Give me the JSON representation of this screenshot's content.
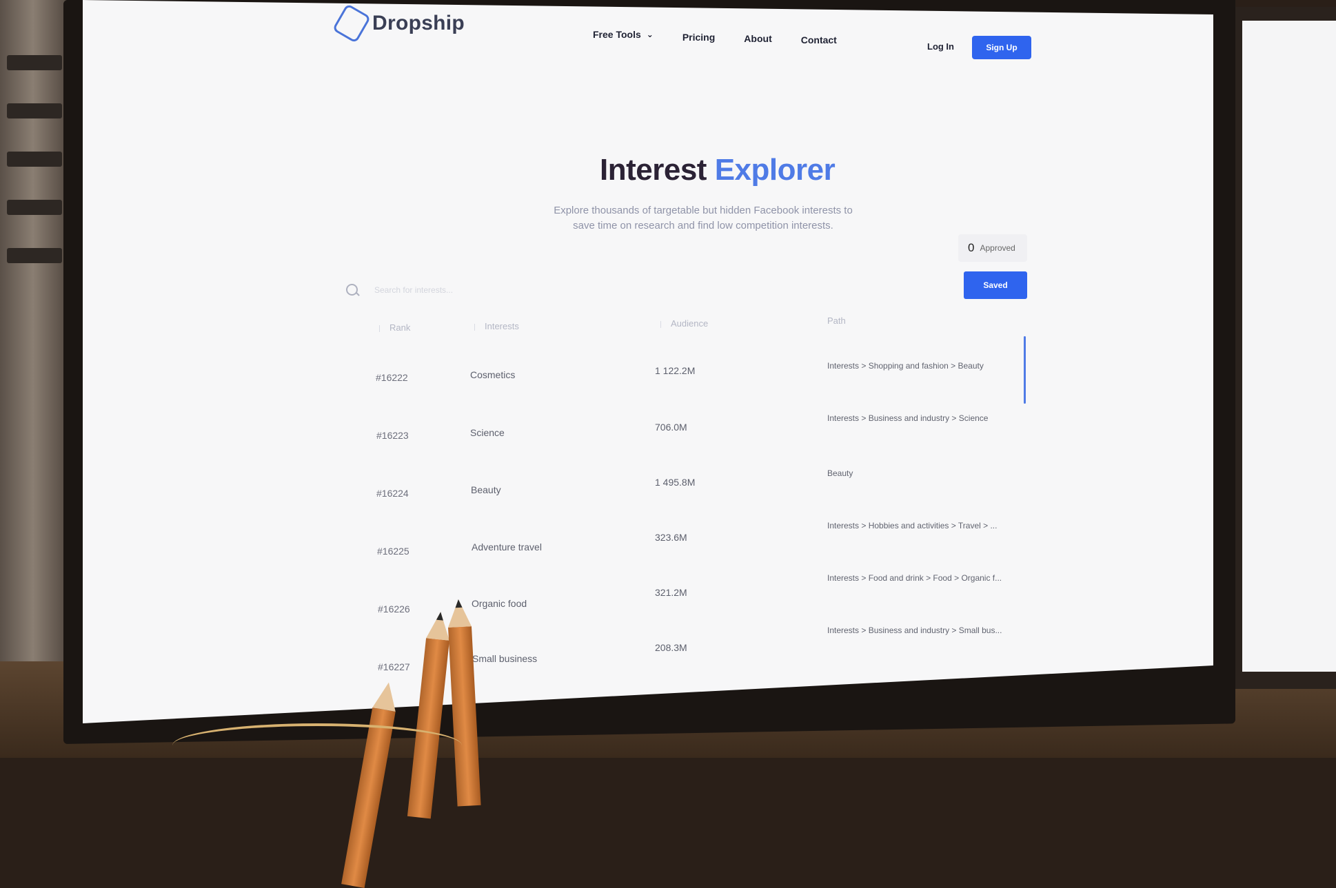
{
  "header": {
    "logo_text": "Dropship",
    "nav": [
      {
        "label": "Free Tools",
        "has_dropdown": true
      },
      {
        "label": "Pricing"
      },
      {
        "label": "About"
      },
      {
        "label": "Contact"
      }
    ],
    "login_label": "Log In",
    "signup_label": "Sign Up"
  },
  "hero": {
    "title_part1": "Interest",
    "title_part2": "Explorer",
    "subtitle_line1": "Explore thousands of targetable but hidden Facebook interests to",
    "subtitle_line2": "save time on research and find low competition interests."
  },
  "approved": {
    "count": "0",
    "label": "Approved"
  },
  "saved_label": "Saved",
  "search": {
    "placeholder": "Search for interests..."
  },
  "table": {
    "columns": [
      "Rank",
      "Interests",
      "Audience",
      "Path"
    ],
    "rows": [
      {
        "rank": "#16222",
        "interest": "Cosmetics",
        "audience": "1 122.2M",
        "path": "Interests > Shopping and fashion > Beauty"
      },
      {
        "rank": "#16223",
        "interest": "Science",
        "audience": "706.0M",
        "path": "Interests > Business and industry > Science"
      },
      {
        "rank": "#16224",
        "interest": "Beauty",
        "audience": "1 495.8M",
        "path": "Beauty"
      },
      {
        "rank": "#16225",
        "interest": "Adventure travel",
        "audience": "323.6M",
        "path": "Interests > Hobbies and activities > Travel > ..."
      },
      {
        "rank": "#16226",
        "interest": "Organic food",
        "audience": "321.2M",
        "path": "Interests > Food and drink > Food > Organic f..."
      },
      {
        "rank": "#16227",
        "interest": "Small business",
        "audience": "208.3M",
        "path": "Interests > Business and industry > Small bus..."
      }
    ]
  },
  "colors": {
    "accent": "#2f64ee",
    "title_dark": "#2b2235",
    "title_blue": "#4f7be6"
  }
}
